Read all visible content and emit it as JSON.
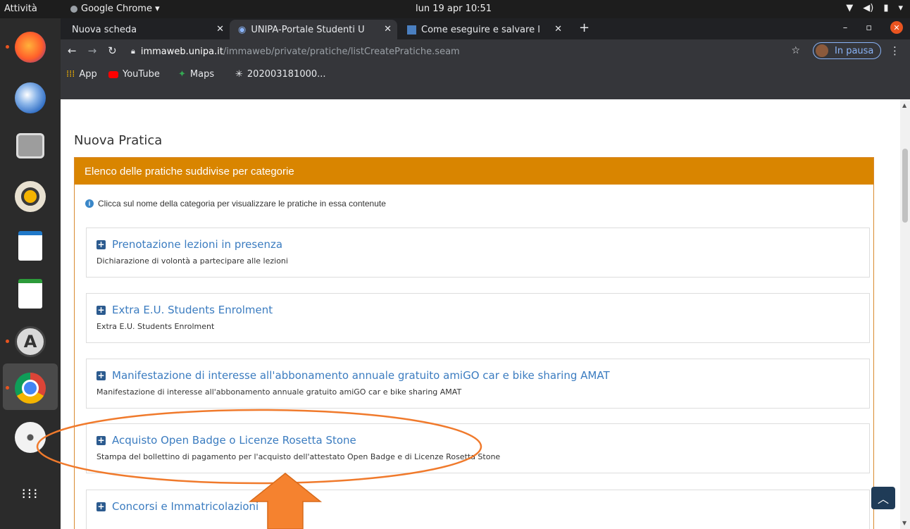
{
  "topbar": {
    "activities": "Attività",
    "app_menu": "Google Chrome ▾",
    "clock": "lun 19 apr  10:51"
  },
  "dock": {
    "items": [
      "firefox-icon",
      "thunderbird-icon",
      "files-icon",
      "rhythmbox-icon",
      "writer-icon",
      "calc-icon",
      "software-icon",
      "chrome-icon",
      "dvd-icon",
      "app-grid-icon"
    ]
  },
  "browser": {
    "tabs": [
      {
        "label": "Nuova scheda"
      },
      {
        "label": "UNIPA-Portale Studenti U"
      },
      {
        "label": "Come eseguire e salvare l"
      }
    ],
    "url_host": "immaweb.unipa.it",
    "url_path": "/immaweb/private/pratiche/listCreatePratiche.seam",
    "profile_label": "In pausa",
    "bookmarks": [
      "App",
      "YouTube",
      "Maps",
      "202003181000..."
    ]
  },
  "page": {
    "title": "Nuova Pratica",
    "panel_header": "Elenco delle pratiche suddivise per categorie",
    "info_text": "Clicca sul nome della categoria per visualizzare le pratiche in essa contenute",
    "categories": [
      {
        "title": "Prenotazione lezioni in presenza",
        "desc": "Dichiarazione di volontà a partecipare alle lezioni"
      },
      {
        "title": "Extra E.U. Students Enrolment",
        "desc": "Extra E.U. Students Enrolment"
      },
      {
        "title": "Manifestazione di interesse all'abbonamento annuale gratuito amiGO car e bike sharing AMAT",
        "desc": "Manifestazione di interesse all'abbonamento annuale gratuito amiGO car e bike sharing AMAT"
      },
      {
        "title": "Acquisto Open Badge o Licenze Rosetta Stone",
        "desc": "Stampa del bollettino di pagamento per l'acquisto dell'attestato Open Badge e di Licenze Rosetta Stone"
      },
      {
        "title": "Concorsi e Immatricolazioni",
        "desc": ""
      }
    ]
  },
  "colors": {
    "panel_header": "#d98500",
    "link": "#3b7cc0",
    "annotation": "#f07a2c"
  }
}
